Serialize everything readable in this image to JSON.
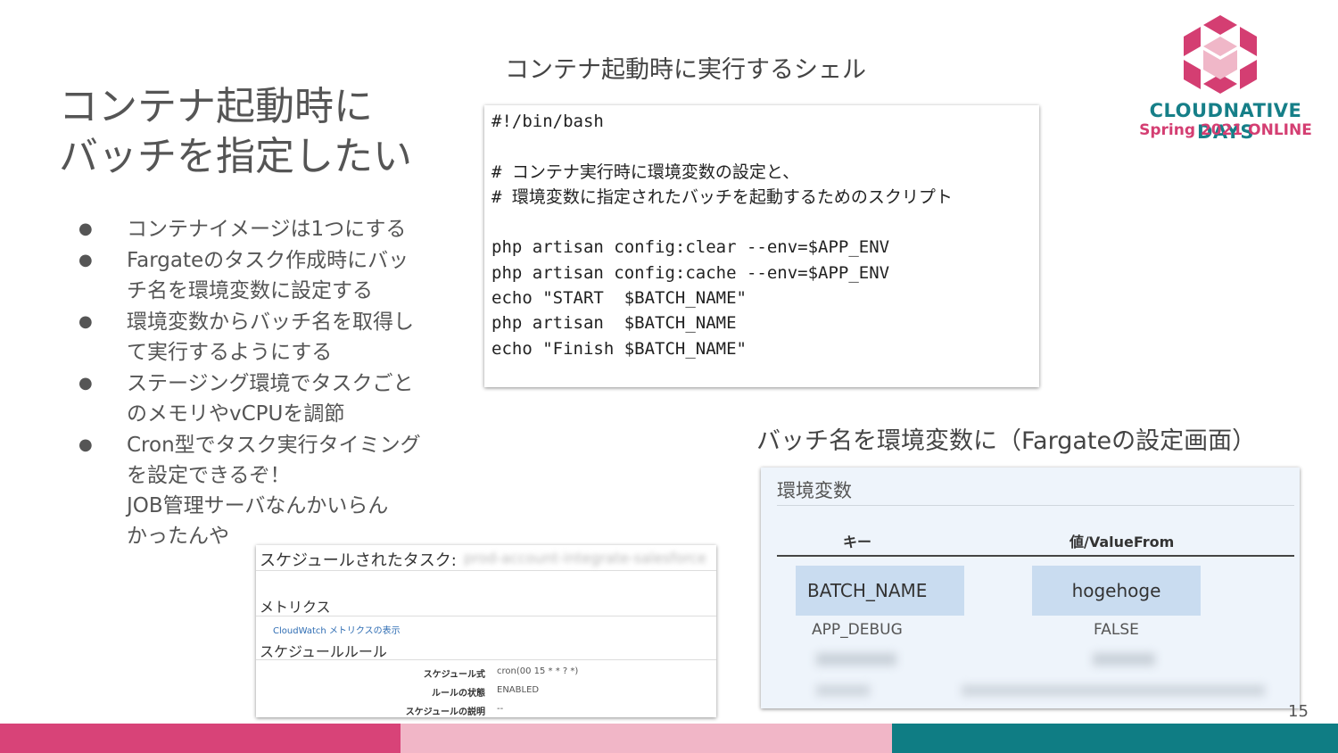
{
  "slide": {
    "title_lines": [
      "コンテナ起動時に",
      "バッチを指定したい"
    ],
    "bullet_symbol": "●",
    "bullets": [
      [
        "コンテナイメージは1つにする"
      ],
      [
        "Fargateのタスク作成時にバッ",
        "チ名を環境変数に設定する"
      ],
      [
        "環境変数からバッチ名を取得し",
        "て実行するようにする"
      ],
      [
        "ステージング環境でタスクごと",
        "のメモリやvCPUを調節"
      ],
      [
        "Cron型でタスク実行タイミング",
        "を設定できるぞ！",
        "JOB管理サーバなんかいらん",
        "かったんや"
      ]
    ],
    "page_number": "15"
  },
  "shell": {
    "caption": "コンテナ起動時に実行するシェル",
    "lines": [
      "#!/bin/bash",
      "",
      "# コンテナ実行時に環境変数の設定と、",
      "# 環境変数に指定されたバッチを起動するためのスクリプト",
      "",
      "php artisan config:clear --env=$APP_ENV",
      "php artisan config:cache --env=$APP_ENV",
      "echo \"START  $BATCH_NAME\"",
      "php artisan  $BATCH_NAME",
      "echo \"Finish $BATCH_NAME\""
    ]
  },
  "env": {
    "caption": "バッチ名を環境変数に（Fargateの設定画面）",
    "title": "環境変数",
    "col_key": "キー",
    "col_value": "値/ValueFrom",
    "rows": [
      {
        "key": "BATCH_NAME",
        "value": "hogehoge"
      },
      {
        "key": "APP_DEBUG",
        "value": "FALSE"
      }
    ]
  },
  "schedule": {
    "title": "スケジュールされたタスク:",
    "task_name": "prod-account-integrate-salesforce",
    "metrics_heading": "メトリクス",
    "metrics_link": "CloudWatch メトリクスの表示",
    "rules_heading": "スケジュールルール",
    "fields": [
      {
        "label": "スケジュール式",
        "value": "cron(00 15 * * ? *)"
      },
      {
        "label": "ルールの状態",
        "value": "ENABLED"
      },
      {
        "label": "スケジュールの説明",
        "value": "--"
      }
    ]
  },
  "logo": {
    "line1": "CLOUDNATIVE DAYS",
    "line2": "Spring 2021 ONLINE",
    "colors": {
      "pink": "#d43e72",
      "light_pink": "#f0b7c8",
      "teal": "#167f88"
    }
  },
  "footer_bar_colors": [
    "#d84378",
    "#f1b6c7",
    "#0f7d84"
  ]
}
